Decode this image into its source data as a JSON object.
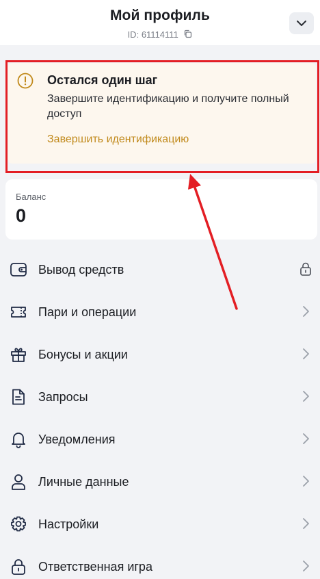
{
  "header": {
    "title": "Мой профиль",
    "id_label": "ID:",
    "id_value": "61114111"
  },
  "warning": {
    "title": "Остался один шаг",
    "text": "Завершите идентификацию и получите полный доступ",
    "link": "Завершить идентификацию"
  },
  "balance": {
    "label": "Баланс",
    "value": "0"
  },
  "menu": {
    "items": [
      {
        "label": "Вывод средств",
        "icon": "wallet-icon",
        "trail": "lock-icon"
      },
      {
        "label": "Пари и операции",
        "icon": "ticket-icon",
        "trail": "chevron-right-icon"
      },
      {
        "label": "Бонусы и акции",
        "icon": "gift-icon",
        "trail": "chevron-right-icon"
      },
      {
        "label": "Запросы",
        "icon": "document-icon",
        "trail": "chevron-right-icon"
      },
      {
        "label": "Уведомления",
        "icon": "bell-icon",
        "trail": "chevron-right-icon"
      },
      {
        "label": "Личные данные",
        "icon": "user-icon",
        "trail": "chevron-right-icon"
      },
      {
        "label": "Настройки",
        "icon": "gear-icon",
        "trail": "chevron-right-icon"
      },
      {
        "label": "Ответственная игра",
        "icon": "padlock-icon",
        "trail": "chevron-right-icon"
      }
    ]
  },
  "colors": {
    "accent_link": "#c18a1c",
    "warning_bg": "#fdf7ee",
    "highlight": "#e31e24",
    "page_bg": "#f2f3f6"
  }
}
